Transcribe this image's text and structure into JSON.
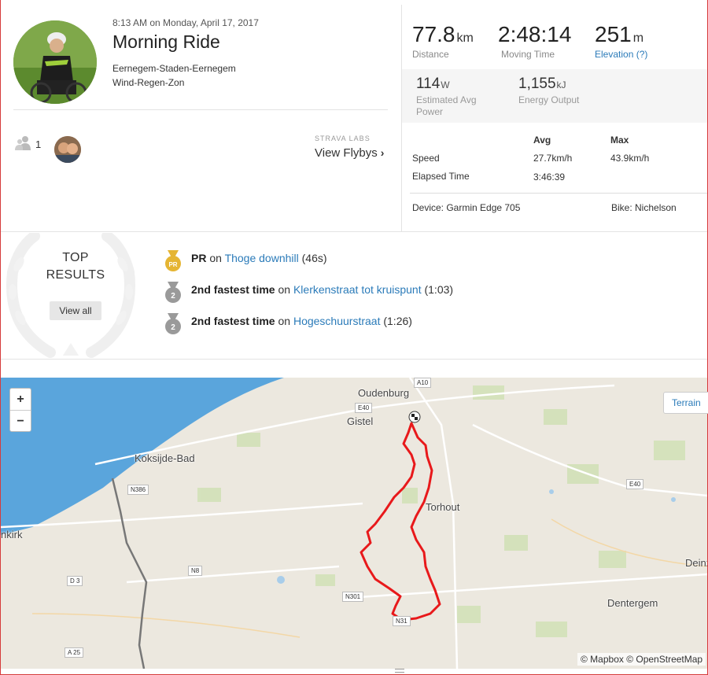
{
  "activity": {
    "datetime": "8:13 AM on Monday, April 17, 2017",
    "title": "Morning Ride",
    "description_lines": [
      "Eernegem-Staden-Eernegem",
      "Wind-Regen-Zon"
    ],
    "athletes_count": "1",
    "flybys_label": "STRAVA LABS",
    "flybys_link": "View Flybys",
    "flybys_chevron": "›"
  },
  "stats": {
    "distance": {
      "value": "77.8",
      "unit": "km",
      "label": "Distance"
    },
    "moving_time": {
      "value": "2:48:14",
      "unit": "",
      "label": "Moving Time"
    },
    "elevation": {
      "value": "251",
      "unit": "m",
      "label": "Elevation (?)"
    },
    "power": {
      "value": "114",
      "unit": "W",
      "label_lines": [
        "Estimated Avg",
        "Power"
      ]
    },
    "energy": {
      "value": "1,155",
      "unit": "kJ",
      "label": "Energy Output"
    }
  },
  "more_stats": {
    "headers": [
      "Avg",
      "Max"
    ],
    "rows": [
      {
        "label": "Speed",
        "avg": "27.7km/h",
        "max": "43.9km/h"
      },
      {
        "label": "Elapsed Time",
        "avg": "3:46:39",
        "max": ""
      }
    ],
    "device": "Device: Garmin Edge 705",
    "bike": "Bike: Nichelson"
  },
  "results": {
    "heading_lines": [
      "TOP",
      "RESULTS"
    ],
    "view_all": "View all",
    "achievements": [
      {
        "medal": "PR",
        "rank_text": "PR",
        "segment": "Thoge downhill",
        "time": "(46s)"
      },
      {
        "medal": "2",
        "rank_text": "2nd fastest time",
        "segment": "Klerkenstraat tot kruispunt",
        "time": "(1:03)"
      },
      {
        "medal": "2",
        "rank_text": "2nd fastest time",
        "segment": "Hogeschuurstraat",
        "time": "(1:26)"
      }
    ],
    "on_word": "on"
  },
  "map": {
    "zoom_in": "+",
    "zoom_out": "−",
    "terrain_button": "Terrain",
    "attribution": "© Mapbox © OpenStreetMap",
    "places": [
      "Oudenburg",
      "Gistel",
      "Koksijde-Bad",
      "Torhout",
      "nkirk",
      "Dentergem",
      "Deinz"
    ],
    "roads": [
      "A10",
      "E40",
      "N386",
      "E40",
      "N8",
      "D 3",
      "N301",
      "N31",
      "A 25"
    ]
  },
  "colors": {
    "link": "#2b7bb9",
    "route": "#e8191b",
    "sea": "#5aa5dc",
    "pr_medal": "#e5b533",
    "silver_medal": "#9a9a9a"
  }
}
